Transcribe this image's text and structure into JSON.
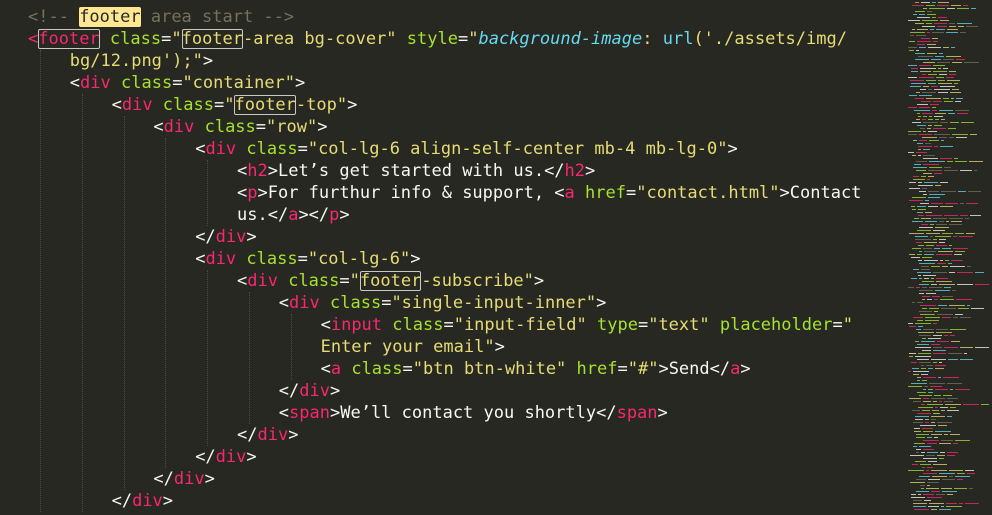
{
  "editor": {
    "theme_colors": {
      "background": "#272822",
      "tag": "#f92672",
      "attribute": "#a6e22e",
      "string": "#e6db74",
      "text": "#f8f8f2",
      "comment": "#75715e",
      "property": "#66d9ef"
    },
    "lines": [
      {
        "indent": 0,
        "tokens": [
          [
            "com",
            "<!-- "
          ],
          [
            "comhl",
            "footer"
          ],
          [
            "com",
            " area start -->"
          ]
        ]
      },
      {
        "indent": 0,
        "tokens": [
          [
            "tag",
            "<"
          ],
          [
            "taghl",
            "footer"
          ],
          [
            "attr",
            " class"
          ],
          [
            "txt",
            "="
          ],
          [
            "str",
            "\""
          ],
          [
            "strhl",
            "footer"
          ],
          [
            "str",
            "-area bg-cover\""
          ],
          [
            "attr",
            " style"
          ],
          [
            "txt",
            "="
          ],
          [
            "str",
            "\""
          ],
          [
            "prop",
            "background-image"
          ],
          [
            "str",
            ": "
          ],
          [
            "fn",
            "url"
          ],
          [
            "str",
            "('./assets/img/"
          ]
        ]
      },
      {
        "indent": 1,
        "tokens": [
          [
            "str",
            "bg/12.png');\""
          ],
          [
            "txt",
            ">"
          ]
        ]
      },
      {
        "indent": 1,
        "tokens": [
          [
            "txt",
            "<"
          ],
          [
            "tag",
            "div"
          ],
          [
            "attr",
            " class"
          ],
          [
            "txt",
            "="
          ],
          [
            "str",
            "\"container\""
          ],
          [
            "txt",
            ">"
          ]
        ]
      },
      {
        "indent": 2,
        "tokens": [
          [
            "txt",
            "<"
          ],
          [
            "tag",
            "div"
          ],
          [
            "attr",
            " class"
          ],
          [
            "txt",
            "="
          ],
          [
            "str",
            "\""
          ],
          [
            "strhl",
            "footer"
          ],
          [
            "str",
            "-top\""
          ],
          [
            "txt",
            ">"
          ]
        ]
      },
      {
        "indent": 3,
        "tokens": [
          [
            "txt",
            "<"
          ],
          [
            "tag",
            "div"
          ],
          [
            "attr",
            " class"
          ],
          [
            "txt",
            "="
          ],
          [
            "str",
            "\"row\""
          ],
          [
            "txt",
            ">"
          ]
        ]
      },
      {
        "indent": 4,
        "tokens": [
          [
            "txt",
            "<"
          ],
          [
            "tag",
            "div"
          ],
          [
            "attr",
            " class"
          ],
          [
            "txt",
            "="
          ],
          [
            "str",
            "\"col-lg-6 align-self-center mb-4 mb-lg-0\""
          ],
          [
            "txt",
            ">"
          ]
        ]
      },
      {
        "indent": 5,
        "tokens": [
          [
            "txt",
            "<"
          ],
          [
            "tag",
            "h2"
          ],
          [
            "txt",
            ">Let’s get started with us.</"
          ],
          [
            "tag",
            "h2"
          ],
          [
            "txt",
            ">"
          ]
        ]
      },
      {
        "indent": 5,
        "tokens": [
          [
            "txt",
            "<"
          ],
          [
            "tag",
            "p"
          ],
          [
            "txt",
            ">For furthur info & support, <"
          ],
          [
            "tag",
            "a"
          ],
          [
            "attr",
            " href"
          ],
          [
            "txt",
            "="
          ],
          [
            "str",
            "\"contact.html\""
          ],
          [
            "txt",
            ">Contact"
          ]
        ]
      },
      {
        "indent": 5,
        "tokens": [
          [
            "txt",
            "us.</"
          ],
          [
            "tag",
            "a"
          ],
          [
            "txt",
            "></"
          ],
          [
            "tag",
            "p"
          ],
          [
            "txt",
            ">"
          ]
        ]
      },
      {
        "indent": 4,
        "tokens": [
          [
            "txt",
            "</"
          ],
          [
            "tag",
            "div"
          ],
          [
            "txt",
            ">"
          ]
        ]
      },
      {
        "indent": 4,
        "tokens": [
          [
            "txt",
            "<"
          ],
          [
            "tag",
            "div"
          ],
          [
            "attr",
            " class"
          ],
          [
            "txt",
            "="
          ],
          [
            "str",
            "\"col-lg-6\""
          ],
          [
            "txt",
            ">"
          ]
        ]
      },
      {
        "indent": 5,
        "tokens": [
          [
            "txt",
            "<"
          ],
          [
            "tag",
            "div"
          ],
          [
            "attr",
            " class"
          ],
          [
            "txt",
            "="
          ],
          [
            "str",
            "\""
          ],
          [
            "strhl",
            "footer"
          ],
          [
            "str",
            "-subscribe\""
          ],
          [
            "txt",
            ">"
          ]
        ]
      },
      {
        "indent": 6,
        "tokens": [
          [
            "txt",
            "<"
          ],
          [
            "tag",
            "div"
          ],
          [
            "attr",
            " class"
          ],
          [
            "txt",
            "="
          ],
          [
            "str",
            "\"single-input-inner\""
          ],
          [
            "txt",
            ">"
          ]
        ]
      },
      {
        "indent": 7,
        "tokens": [
          [
            "txt",
            "<"
          ],
          [
            "tag",
            "input"
          ],
          [
            "attr",
            " class"
          ],
          [
            "txt",
            "="
          ],
          [
            "str",
            "\"input-field\""
          ],
          [
            "attr",
            " type"
          ],
          [
            "txt",
            "="
          ],
          [
            "str",
            "\"text\""
          ],
          [
            "attr",
            " placeholder"
          ],
          [
            "txt",
            "="
          ],
          [
            "str",
            "\""
          ]
        ]
      },
      {
        "indent": 7,
        "tokens": [
          [
            "str",
            "Enter your email\""
          ],
          [
            "txt",
            ">"
          ]
        ]
      },
      {
        "indent": 7,
        "tokens": [
          [
            "txt",
            "<"
          ],
          [
            "tag",
            "a"
          ],
          [
            "attr",
            " class"
          ],
          [
            "txt",
            "="
          ],
          [
            "str",
            "\"btn btn-white\""
          ],
          [
            "attr",
            " href"
          ],
          [
            "txt",
            "="
          ],
          [
            "str",
            "\"#\""
          ],
          [
            "txt",
            ">Send</"
          ],
          [
            "tag",
            "a"
          ],
          [
            "txt",
            ">"
          ]
        ]
      },
      {
        "indent": 6,
        "tokens": [
          [
            "txt",
            "</"
          ],
          [
            "tag",
            "div"
          ],
          [
            "txt",
            ">"
          ]
        ]
      },
      {
        "indent": 6,
        "tokens": [
          [
            "txt",
            "<"
          ],
          [
            "tag",
            "span"
          ],
          [
            "txt",
            ">We’ll contact you shortly</"
          ],
          [
            "tag",
            "span"
          ],
          [
            "txt",
            ">"
          ]
        ]
      },
      {
        "indent": 5,
        "tokens": [
          [
            "txt",
            "</"
          ],
          [
            "tag",
            "div"
          ],
          [
            "txt",
            ">"
          ]
        ]
      },
      {
        "indent": 4,
        "tokens": [
          [
            "txt",
            "</"
          ],
          [
            "tag",
            "div"
          ],
          [
            "txt",
            ">"
          ]
        ]
      },
      {
        "indent": 3,
        "tokens": [
          [
            "txt",
            "</"
          ],
          [
            "tag",
            "div"
          ],
          [
            "txt",
            ">"
          ]
        ]
      },
      {
        "indent": 2,
        "tokens": [
          [
            "txt",
            "</"
          ],
          [
            "tag",
            "div"
          ],
          [
            "txt",
            ">"
          ]
        ]
      }
    ]
  }
}
